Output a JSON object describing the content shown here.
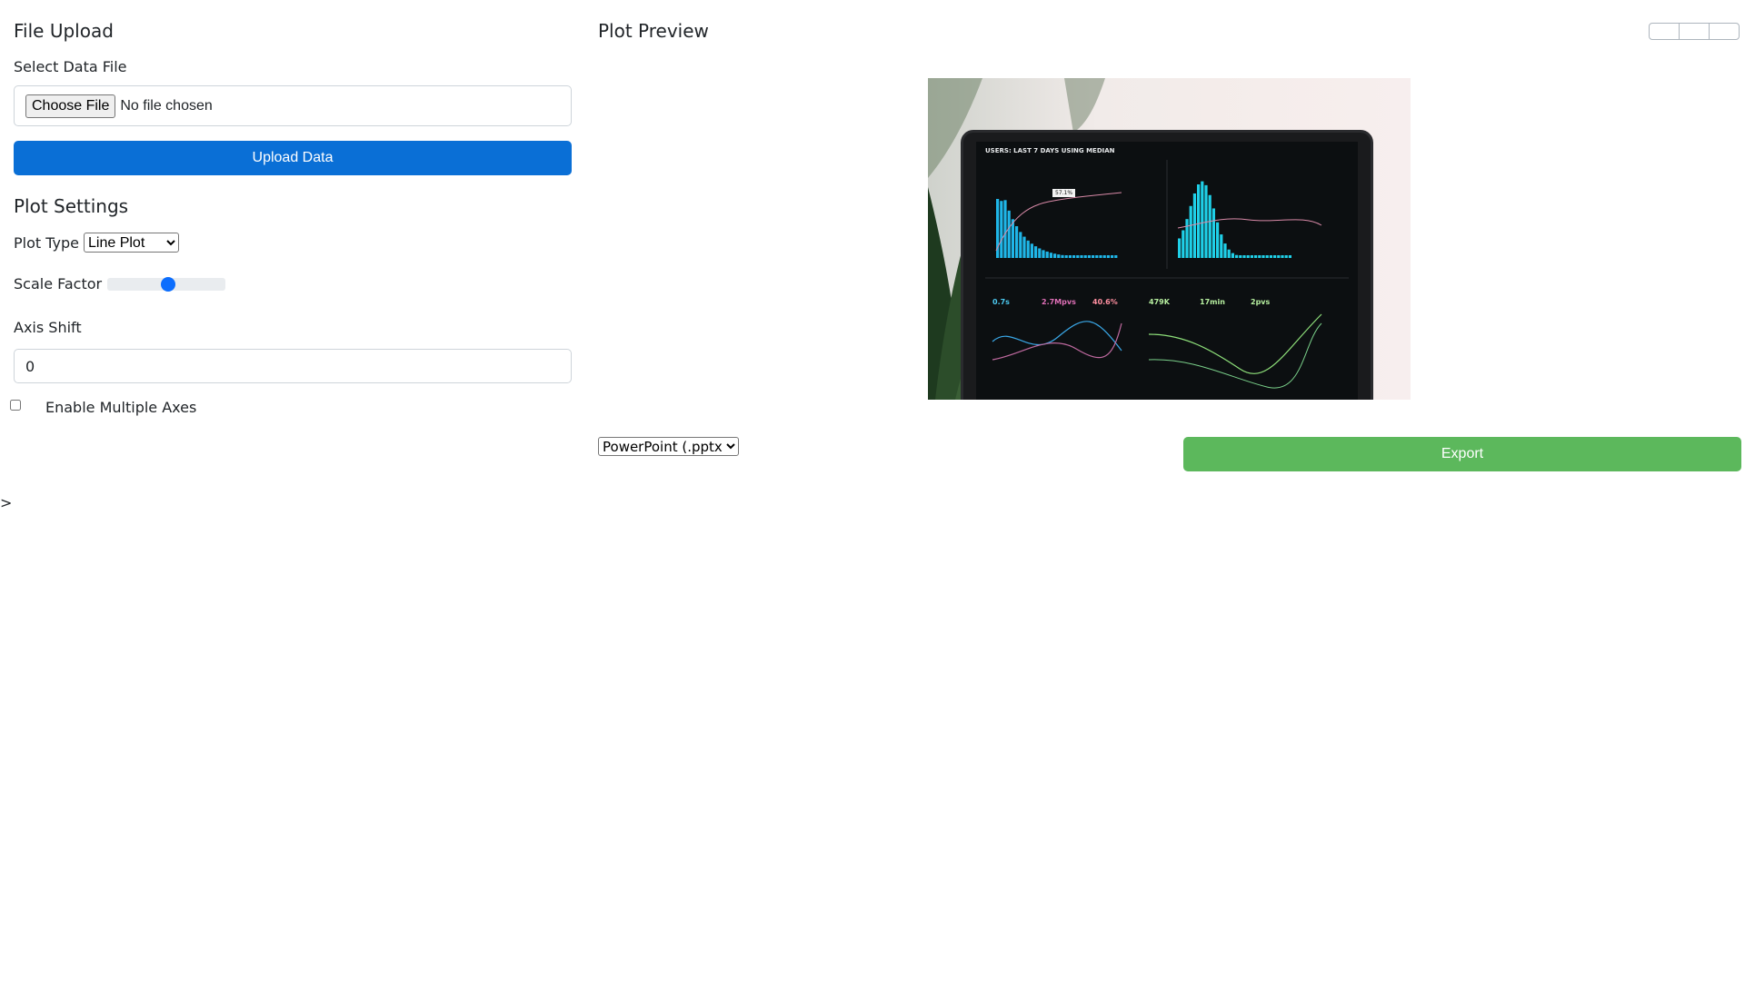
{
  "file_upload": {
    "title": "File Upload",
    "file_label": "Select Data File",
    "choose_button": "Choose File",
    "no_file_text": "No file chosen",
    "upload_button": "Upload Data"
  },
  "plot_settings": {
    "title": "Plot Settings",
    "plot_type_label": "Plot Type",
    "plot_type_selected": "Line Plot",
    "scale_label": "Scale Factor",
    "scale_value_fraction": 0.5,
    "axis_shift_label": "Axis Shift",
    "axis_shift_value": "0",
    "multiple_axes_label": "Enable Multiple Axes",
    "multiple_axes_checked": false
  },
  "stray_text": ">",
  "preview": {
    "title": "Plot Preview",
    "image": {
      "heading": "USERS: LAST 7 DAYS USING MEDIAN",
      "tooltip_value": "57.1%",
      "metrics": [
        "0.7s",
        "2.7Mpvs",
        "40.6%",
        "479K",
        "17min",
        "2pvs"
      ]
    }
  },
  "export": {
    "format_selected": "PowerPoint (.pptx)",
    "button": "Export"
  },
  "colors": {
    "primary": "#0a6fd6",
    "success": "#5cb85c",
    "slider": "#0d6efd"
  }
}
